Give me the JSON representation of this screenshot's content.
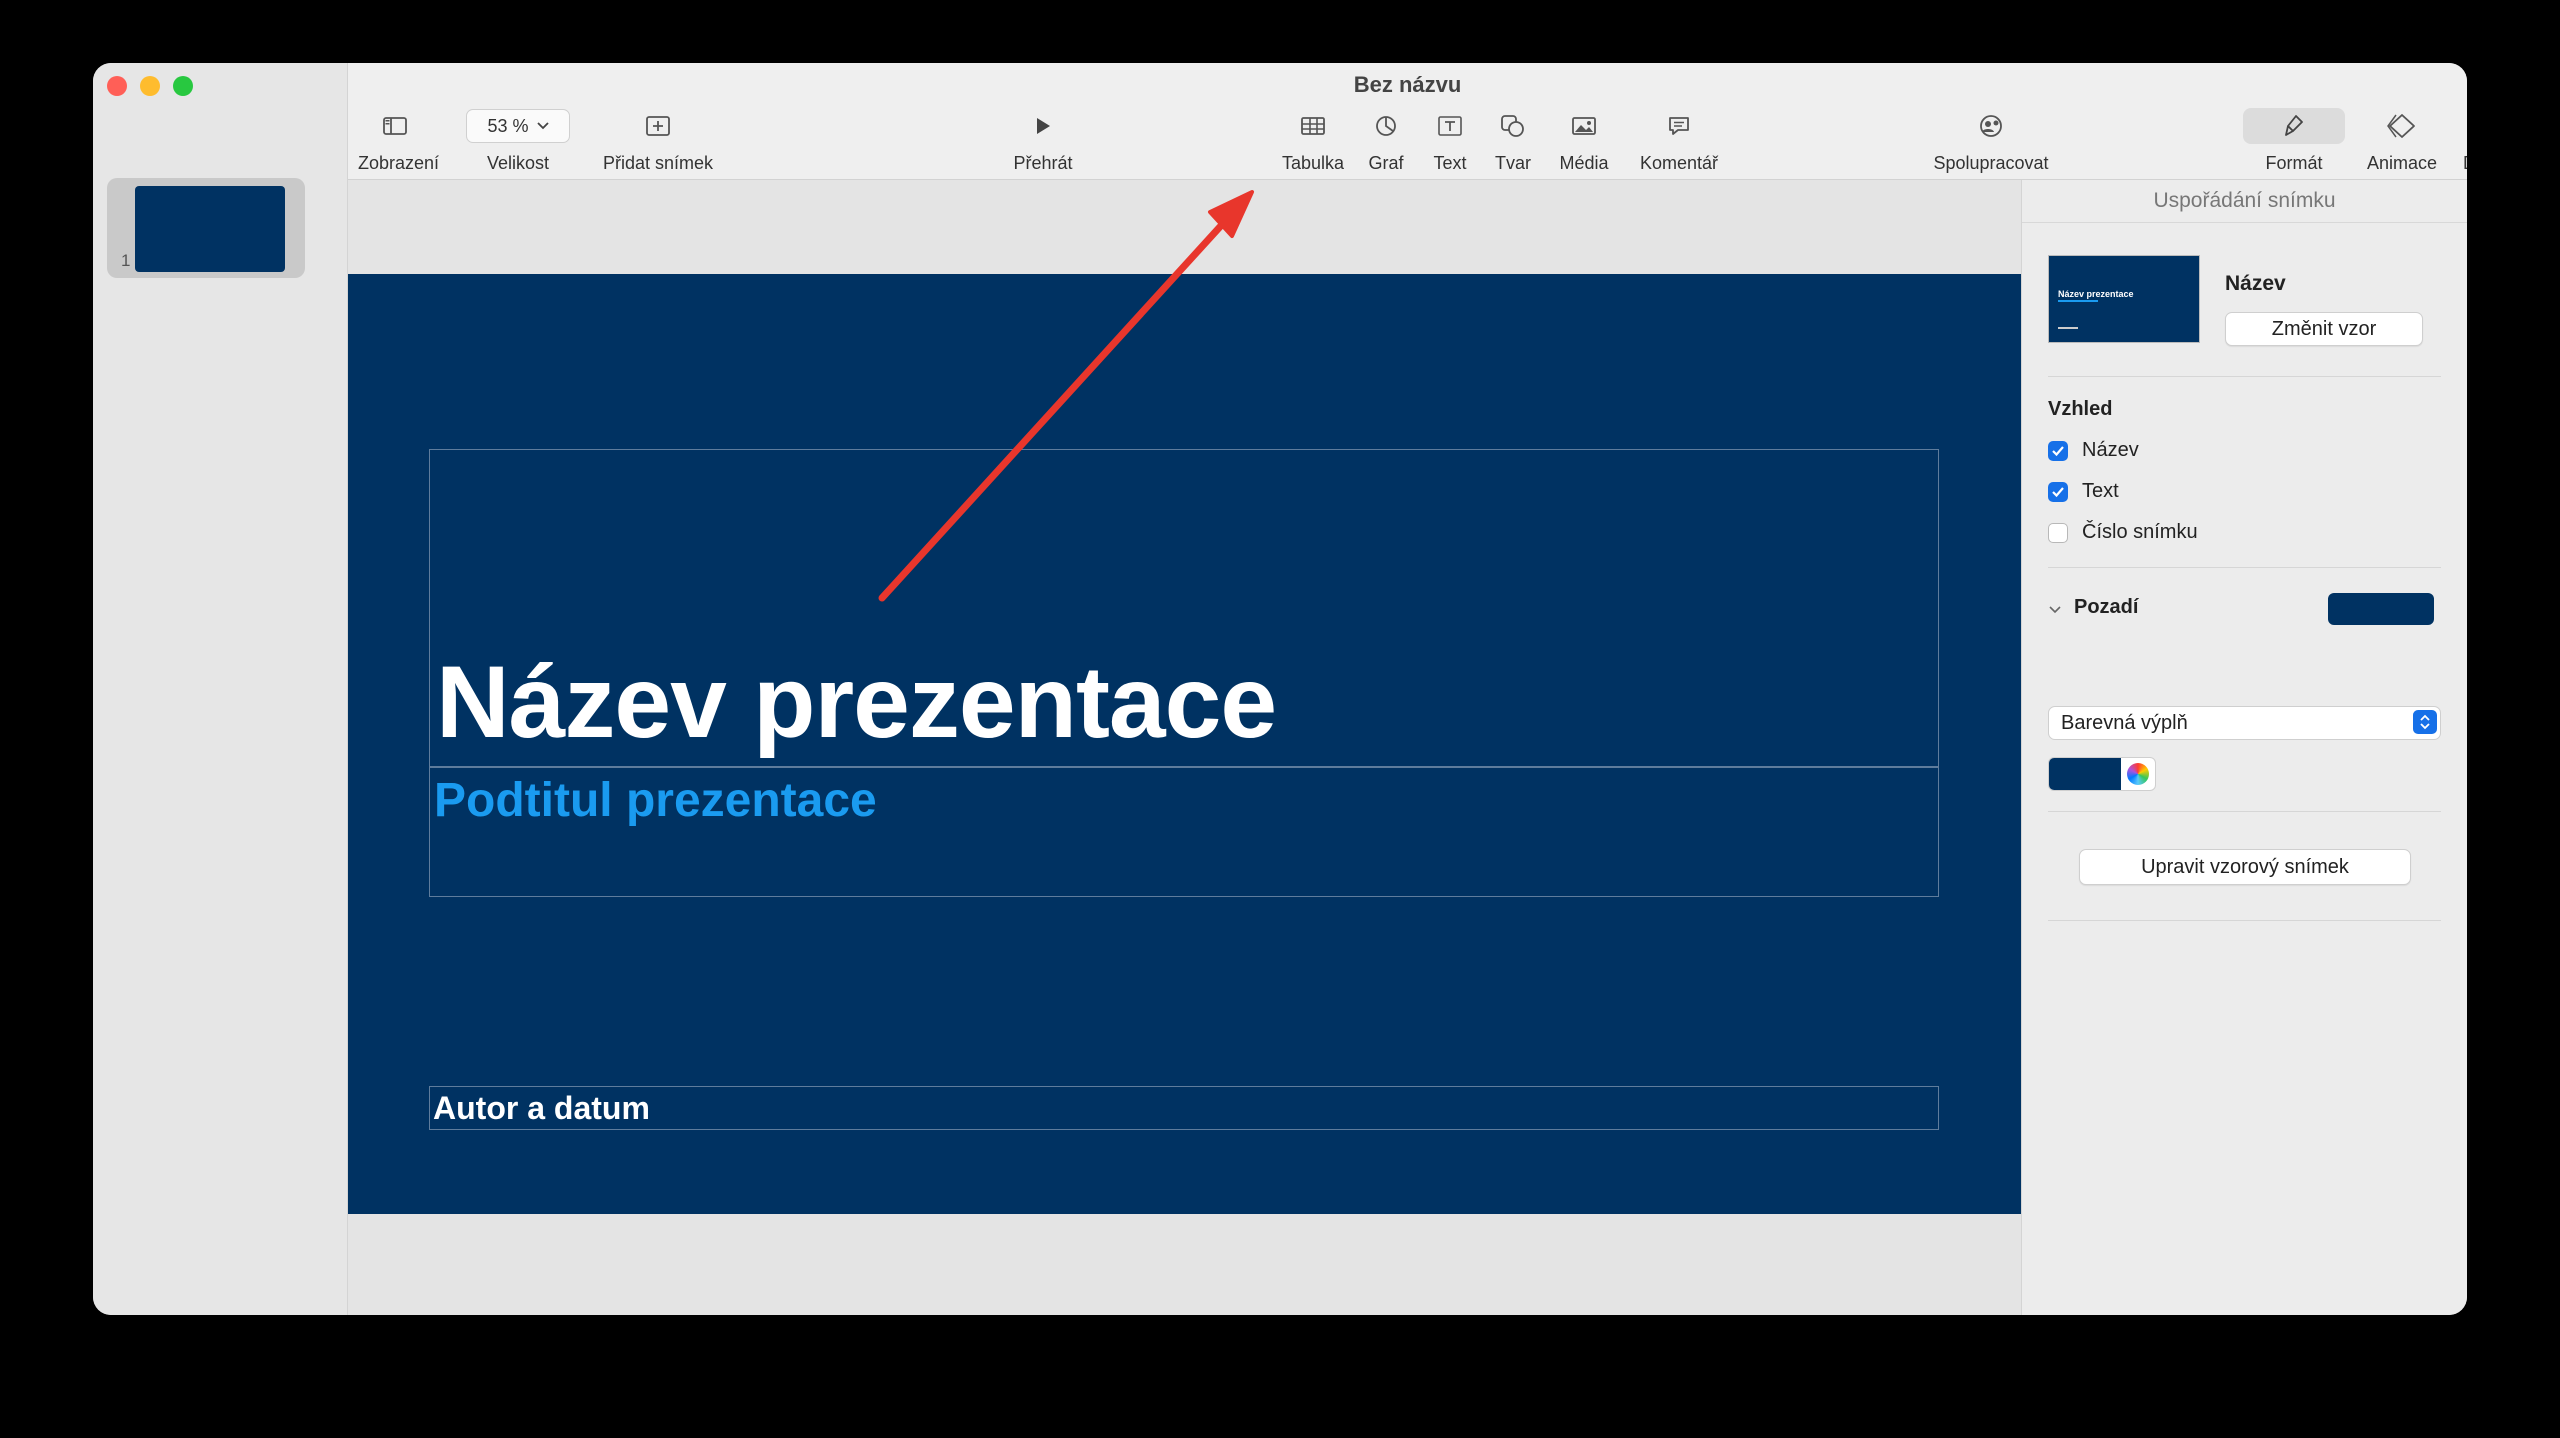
{
  "window": {
    "title": "Bez názvu"
  },
  "navigator": {
    "slides": [
      {
        "number": "1"
      }
    ]
  },
  "toolbar": {
    "view_label": "Zobrazení",
    "zoom_value": "53 %",
    "zoom_label": "Velikost",
    "add_slide_label": "Přidat snímek",
    "play_label": "Přehrát",
    "table_label": "Tabulka",
    "chart_label": "Graf",
    "text_label": "Text",
    "shape_label": "Tvar",
    "media_label": "Média",
    "comment_label": "Komentář",
    "collaborate_label": "Spolupracovat",
    "format_label": "Formát",
    "animate_label": "Animace",
    "document_label": "Dokument"
  },
  "slide": {
    "title": "Název prezentace",
    "subtitle": "Podtitul prezentace",
    "author": "Autor a datum",
    "background_color": "#003262",
    "subtitle_color": "#1a9bf0"
  },
  "inspector": {
    "header": "Uspořádání snímku",
    "layout_name": "Název",
    "layout_thumb_title": "Název prezentace",
    "change_master_button": "Změnit vzor",
    "appearance_title": "Vzhled",
    "checkboxes": [
      {
        "label": "Název",
        "checked": true
      },
      {
        "label": "Text",
        "checked": true
      },
      {
        "label": "Číslo snímku",
        "checked": false
      }
    ],
    "background_title": "Pozadí",
    "fill_type": "Barevná výplň",
    "edit_master_button": "Upravit vzorový snímek",
    "accent_color": "#1670e8"
  },
  "annotation": {
    "arrow_color": "#e8362c",
    "icons": [
      "sidebar-icon",
      "table-icon",
      "chart-icon",
      "text-box-icon",
      "shape-icon",
      "media-icon",
      "comment-icon",
      "collaborate-icon",
      "format-brush-icon",
      "animate-icon",
      "document-icon",
      "play-icon",
      "add-slide-icon"
    ]
  }
}
